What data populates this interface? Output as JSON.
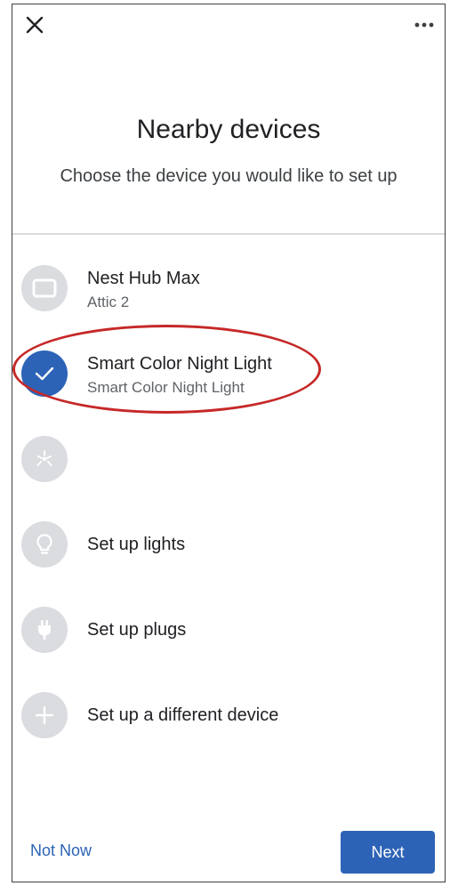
{
  "header": {
    "close_icon": "close-icon",
    "more_icon": "more-horizontal-icon"
  },
  "title": "Nearby devices",
  "subtitle": "Choose the device you would like to set up",
  "devices": [
    {
      "name": "Nest Hub Max",
      "subtitle": "Attic 2",
      "icon": "display-icon",
      "selected": false
    },
    {
      "name": "Smart Color Night Light",
      "subtitle": "Smart Color Night Light",
      "icon": "check-icon",
      "selected": true
    },
    {
      "name": "",
      "subtitle": "",
      "icon": "light-fixture-icon",
      "selected": false
    },
    {
      "name": "Set up lights",
      "subtitle": "",
      "icon": "lightbulb-icon",
      "selected": false
    },
    {
      "name": "Set up plugs",
      "subtitle": "",
      "icon": "plug-icon",
      "selected": false
    },
    {
      "name": "Set up a different device",
      "subtitle": "",
      "icon": "plus-icon",
      "selected": false
    }
  ],
  "footer": {
    "not_now_label": "Not Now",
    "next_label": "Next"
  },
  "colors": {
    "accent": "#2c63b6",
    "highlight": "#c62828",
    "icon_bg": "#dadce0"
  }
}
